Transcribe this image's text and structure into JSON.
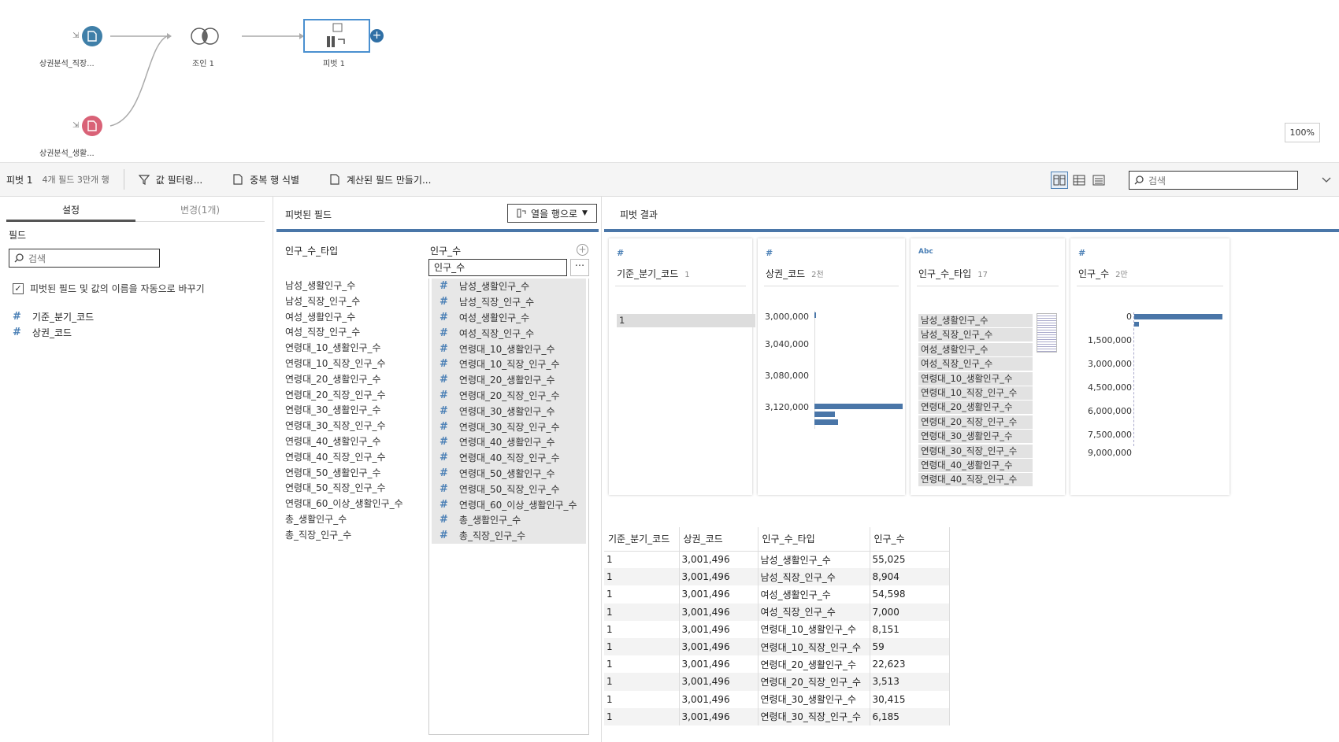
{
  "flow": {
    "nodes": [
      {
        "label": "상권분석_직장...",
        "color": "#3f7fa8"
      },
      {
        "label": "조인 1"
      },
      {
        "label": "피벗 1"
      },
      {
        "label": "상권분석_생활...",
        "color": "#d96277"
      }
    ],
    "zoom": "100%"
  },
  "toolbar": {
    "title": "피벗 1",
    "meta": "4개 필드  3만개 행",
    "filter_label": "값 필터링...",
    "dedupe_label": "중복 행 식별",
    "calc_label": "계산된 필드 만들기...",
    "search_placeholder": "검색"
  },
  "left": {
    "tab_settings": "설정",
    "tab_changes": "변경(1개)",
    "fields_title": "필드",
    "search_placeholder": "검색",
    "rename_checkbox": "피벗된 필드 및 값의 이름을 자동으로 바꾸기",
    "rename_checked": true,
    "fields": [
      "기준_분기_코드",
      "상권_코드"
    ]
  },
  "pivot": {
    "title": "피벗된 필드",
    "dropdown_label": "열을 행으로",
    "col1_header": "인구_수_타입",
    "col2_header": "인구_수",
    "col2_input_value": "인구_수",
    "more_label": "···",
    "names": [
      "남성_생활인구_수",
      "남성_직장_인구_수",
      "여성_생활인구_수",
      "여성_직장_인구_수",
      "연령대_10_생활인구_수",
      "연령대_10_직장_인구_수",
      "연령대_20_생활인구_수",
      "연령대_20_직장_인구_수",
      "연령대_30_생활인구_수",
      "연령대_30_직장_인구_수",
      "연령대_40_생활인구_수",
      "연령대_40_직장_인구_수",
      "연령대_50_생활인구_수",
      "연령대_50_직장_인구_수",
      "연령대_60_이상_생활인구_수",
      "총_생활인구_수",
      "총_직장_인구_수"
    ]
  },
  "results": {
    "title": "피벗 결과",
    "cards": [
      {
        "type": "#",
        "name": "기준_분기_코드",
        "count": "1",
        "values": [
          "1"
        ]
      },
      {
        "type": "#",
        "name": "상권_코드",
        "count": "2천",
        "ticks": [
          "3,000,000",
          "3,040,000",
          "3,080,000",
          "3,120,000"
        ]
      },
      {
        "type": "Abc",
        "name": "인구_수_타입",
        "count": "17",
        "values": [
          "남성_생활인구_수",
          "남성_직장_인구_수",
          "여성_생활인구_수",
          "여성_직장_인구_수",
          "연령대_10_생활인구_수",
          "연령대_10_직장_인구_수",
          "연령대_20_생활인구_수",
          "연령대_20_직장_인구_수",
          "연령대_30_생활인구_수",
          "연령대_30_직장_인구_수",
          "연령대_40_생활인구_수",
          "연령대_40_직장_인구_수"
        ]
      },
      {
        "type": "#",
        "name": "인구_수",
        "count": "2만",
        "ticks": [
          "0",
          "1,500,000",
          "3,000,000",
          "4,500,000",
          "6,000,000",
          "7,500,000",
          "9,000,000"
        ]
      }
    ],
    "grid": {
      "headers": [
        "기준_분기_코드",
        "상권_코드",
        "인구_수_타입",
        "인구_수"
      ],
      "rows": [
        [
          "1",
          "3,001,496",
          "남성_생활인구_수",
          "55,025"
        ],
        [
          "1",
          "3,001,496",
          "남성_직장_인구_수",
          "8,904"
        ],
        [
          "1",
          "3,001,496",
          "여성_생활인구_수",
          "54,598"
        ],
        [
          "1",
          "3,001,496",
          "여성_직장_인구_수",
          "7,000"
        ],
        [
          "1",
          "3,001,496",
          "연령대_10_생활인구_수",
          "8,151"
        ],
        [
          "1",
          "3,001,496",
          "연령대_10_직장_인구_수",
          "59"
        ],
        [
          "1",
          "3,001,496",
          "연령대_20_생활인구_수",
          "22,623"
        ],
        [
          "1",
          "3,001,496",
          "연령대_20_직장_인구_수",
          "3,513"
        ],
        [
          "1",
          "3,001,496",
          "연령대_30_생활인구_수",
          "30,415"
        ],
        [
          "1",
          "3,001,496",
          "연령대_30_직장_인구_수",
          "6,185"
        ]
      ]
    }
  },
  "colors": {
    "accent": "#4a76a8",
    "source_blue": "#3f7fa8",
    "source_pink": "#d96277"
  }
}
